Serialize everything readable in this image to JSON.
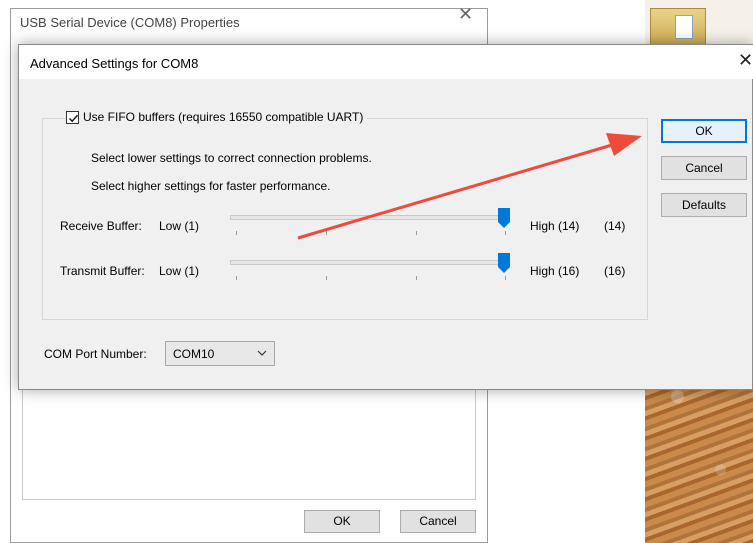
{
  "background_window": {
    "title": "USB Serial Device (COM8) Properties",
    "ok_label": "OK",
    "cancel_label": "Cancel"
  },
  "dialog": {
    "title": "Advanced Settings for COM8",
    "fifo": {
      "checked": true,
      "label": "Use FIFO buffers (requires 16550 compatible UART)"
    },
    "hint_lower": "Select lower settings to correct connection problems.",
    "hint_higher": "Select higher settings for faster performance.",
    "receive_buffer": {
      "label": "Receive Buffer:",
      "low": "Low (1)",
      "high": "High (14)",
      "value": "(14)",
      "level": 1.0
    },
    "transmit_buffer": {
      "label": "Transmit Buffer:",
      "low": "Low (1)",
      "high": "High (16)",
      "value": "(16)",
      "level": 1.0
    },
    "com_port": {
      "label": "COM Port Number:",
      "selected": "COM10"
    },
    "buttons": {
      "ok": "OK",
      "cancel": "Cancel",
      "defaults": "Defaults"
    }
  },
  "colors": {
    "accent": "#0078d7",
    "annotation_arrow": "#ef4b3b",
    "dialog_background": "#f0f0f0"
  },
  "icons": [
    "close-icon",
    "checkmark-icon",
    "chevron-down-icon",
    "folder-icon",
    "arrow-annotation"
  ]
}
